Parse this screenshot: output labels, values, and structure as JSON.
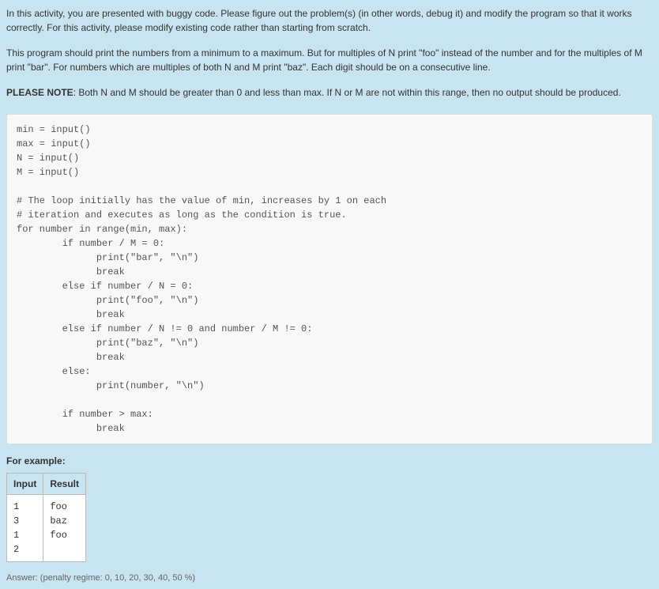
{
  "instructions": {
    "p1": "In this activity, you are presented with buggy code. Please figure out the problem(s) (in other words, debug it) and modify the program so that it works correctly.  For this activity, please modify existing code rather than starting from scratch.",
    "p2": "This program should print the numbers from a minimum to a maximum. But for multiples of N print \"foo\" instead of the number and for the multiples of M print \"bar\". For numbers which are multiples of both N and M print \"baz\". Each digit should be on a consecutive line.",
    "note_label": "PLEASE NOTE",
    "note_text": ": Both N and M should be greater than 0 and less than max.  If N or M are not within this range, then no output should be produced."
  },
  "code": "min = input()\nmax = input()\nN = input()\nM = input()\n\n# The loop initially has the value of min, increases by 1 on each\n# iteration and executes as long as the condition is true.\nfor number in range(min, max):\n        if number / M = 0:\n              print(\"bar\", \"\\n\")\n              break\n        else if number / N = 0:\n              print(\"foo\", \"\\n\")\n              break\n        else if number / N != 0 and number / M != 0:\n              print(\"baz\", \"\\n\")\n              break\n        else:\n              print(number, \"\\n\")\n\n        if number > max:\n              break",
  "example": {
    "label": "For example:",
    "headers": [
      "Input",
      "Result"
    ],
    "input": "1\n3\n1\n2",
    "result": "foo\nbaz\nfoo"
  },
  "footer": "Answer: (penalty regime: 0, 10, 20, 30, 40, 50 %)"
}
